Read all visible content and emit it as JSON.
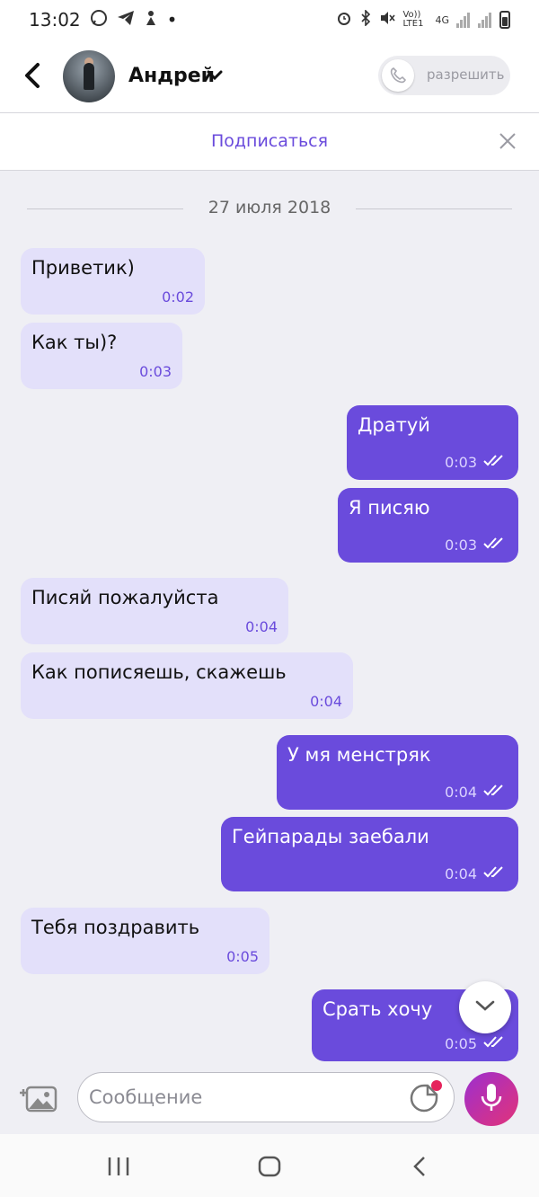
{
  "status_bar": {
    "time": "13:02",
    "dot": "•",
    "volte": "Vo)) LTE1",
    "network": "4G"
  },
  "header": {
    "contact_name": "Андрей",
    "allow_label": "разрешить"
  },
  "subscribe": {
    "label": "Подписаться"
  },
  "date_separator": "27 июля 2018",
  "messages": [
    {
      "dir": "in",
      "text": "Приветик)",
      "time": "0:02"
    },
    {
      "dir": "in",
      "text": "Как ты)?",
      "time": "0:03"
    },
    {
      "dir": "out",
      "text": "Дратуй",
      "time": "0:03"
    },
    {
      "dir": "out",
      "text": "Я писяю",
      "time": "0:03"
    },
    {
      "dir": "in",
      "text": "Писяй пожалуйста",
      "time": "0:04"
    },
    {
      "dir": "in",
      "text": "Как пописяешь, скажешь",
      "time": "0:04"
    },
    {
      "dir": "out",
      "text": "У мя менстряк",
      "time": "0:04"
    },
    {
      "dir": "out",
      "text": "Гейпарады заебали",
      "time": "0:04"
    },
    {
      "dir": "in",
      "text": "Тебя поздравить",
      "time": "0:05"
    },
    {
      "dir": "out",
      "text": "Срать хочу",
      "time": "0:05"
    }
  ],
  "composer": {
    "placeholder": "Сообщение"
  },
  "colors": {
    "accent": "#6a4bdc",
    "incoming_bubble": "#e3e0fa",
    "background": "#efeff4",
    "mic_gradient_end": "#e0337a"
  },
  "icons": [
    "whatsapp-icon",
    "telegram-icon",
    "notification-icon",
    "back-arrow-icon",
    "chevron-down-icon",
    "phone-icon",
    "close-icon",
    "double-check-icon",
    "scroll-down-icon",
    "gallery-icon",
    "sticker-icon",
    "mic-icon",
    "nav-recent-icon",
    "nav-home-icon",
    "nav-back-icon"
  ]
}
